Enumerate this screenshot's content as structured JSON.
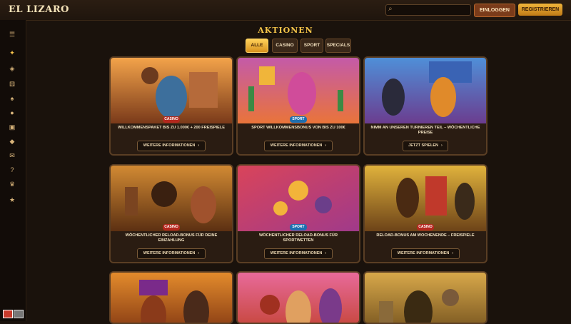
{
  "header": {
    "logo": "EL LIZARO",
    "search_placeholder": "",
    "login_label": "EINLOGGEN",
    "register_label": "REGISTRIEREN"
  },
  "sidebar": {
    "icons": [
      "menu-icon",
      "gift-icon",
      "slots-icon",
      "dice-icon",
      "cards-icon",
      "live-icon",
      "table-icon",
      "jackpot-icon",
      "chat-icon",
      "help-icon",
      "trophy-icon",
      "star-icon"
    ]
  },
  "page": {
    "title": "AKTIONEN"
  },
  "tabs": [
    {
      "label": "ALLE",
      "active": true
    },
    {
      "label": "CASINO",
      "active": false
    },
    {
      "label": "SPORT",
      "active": false
    },
    {
      "label": "SPECIALS",
      "active": false
    }
  ],
  "cards": [
    {
      "badge": "CASINO",
      "text": "WILLKOMMENSPAKET BIS ZU 1.000€ + 200 FREISPIELE",
      "cta": "WEITERE INFORMATIONEN"
    },
    {
      "badge": "SPORT",
      "text": "SPORT WILLKOMMENSBONUS VON BIS ZU 100€",
      "cta": "WEITERE INFORMATIONEN"
    },
    {
      "badge": "",
      "text": "NIMM AN UNSEREN TURNIEREN TEIL – WÖCHENTLICHE PREISE",
      "cta": "JETZT SPIELEN"
    },
    {
      "badge": "CASINO",
      "text": "WÖCHENTLICHER RELOAD-BONUS FÜR DEINE EINZAHLUNG",
      "cta": "WEITERE INFORMATIONEN"
    },
    {
      "badge": "SPORT",
      "text": "WÖCHENTLICHER RELOAD-BONUS FÜR SPORTWETTEN",
      "cta": "WEITERE INFORMATIONEN"
    },
    {
      "badge": "CASINO",
      "text": "RELOAD-BONUS AM WOCHENENDE – FREISPIELE",
      "cta": "WEITERE INFORMATIONEN"
    },
    {
      "badge": "",
      "text": "",
      "cta": ""
    },
    {
      "badge": "",
      "text": "",
      "cta": ""
    },
    {
      "badge": "",
      "text": "",
      "cta": ""
    }
  ]
}
